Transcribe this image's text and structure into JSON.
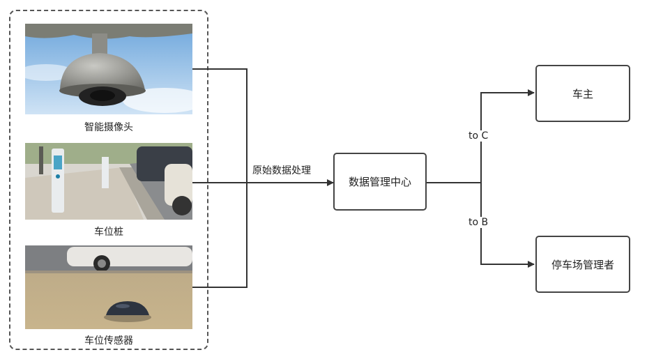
{
  "sources": [
    {
      "label": "智能摄像头",
      "image": "dome-camera-photo"
    },
    {
      "label": "车位桩",
      "image": "parking-post-photo"
    },
    {
      "label": "车位传感器",
      "image": "parking-sensor-photo"
    }
  ],
  "edges": {
    "processing_label": "原始数据处理",
    "to_c_label": "to C",
    "to_b_label": "to B"
  },
  "nodes": {
    "center": "数据管理中心",
    "owner": "车主",
    "manager": "停车场管理者"
  },
  "colors": {
    "line": "#333333",
    "box_border": "#444444",
    "dashed_border": "#555555"
  }
}
